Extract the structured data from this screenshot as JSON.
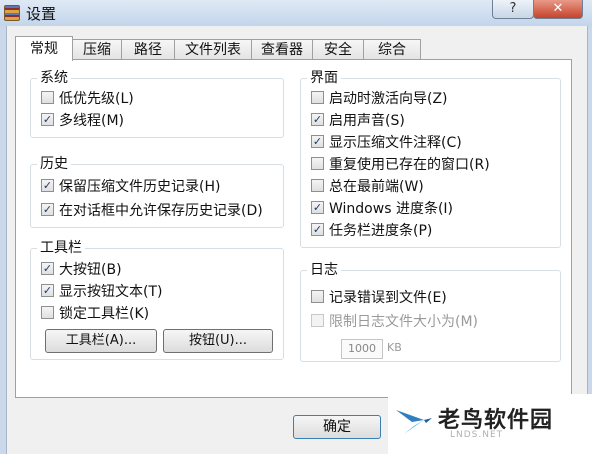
{
  "window": {
    "title": "设置",
    "help_label": "?",
    "close_label": "✕"
  },
  "tabs": [
    {
      "label": "常规",
      "active": true
    },
    {
      "label": "压缩"
    },
    {
      "label": "路径"
    },
    {
      "label": "文件列表"
    },
    {
      "label": "查看器"
    },
    {
      "label": "安全"
    },
    {
      "label": "综合"
    }
  ],
  "system": {
    "title": "系统",
    "items": [
      {
        "label": "低优先级(L)",
        "checked": false
      },
      {
        "label": "多线程(M)",
        "checked": true
      }
    ]
  },
  "history": {
    "title": "历史",
    "items": [
      {
        "label": "保留压缩文件历史记录(H)",
        "checked": true
      },
      {
        "label": "在对话框中允许保存历史记录(D)",
        "checked": true
      }
    ]
  },
  "toolbar": {
    "title": "工具栏",
    "items": [
      {
        "label": "大按钮(B)",
        "checked": true
      },
      {
        "label": "显示按钮文本(T)",
        "checked": true
      },
      {
        "label": "锁定工具栏(K)",
        "checked": false
      }
    ],
    "toolbar_button": "工具栏(A)...",
    "buttons_button": "按钮(U)..."
  },
  "interface": {
    "title": "界面",
    "items": [
      {
        "label": "启动时激活向导(Z)",
        "checked": false
      },
      {
        "label": "启用声音(S)",
        "checked": true
      },
      {
        "label": "显示压缩文件注释(C)",
        "checked": true
      },
      {
        "label": "重复使用已存在的窗口(R)",
        "checked": false
      },
      {
        "label": "总在最前端(W)",
        "checked": false
      },
      {
        "label": "Windows 进度条(I)",
        "checked": true
      },
      {
        "label": "任务栏进度条(P)",
        "checked": true
      }
    ]
  },
  "log": {
    "title": "日志",
    "items": [
      {
        "label": "记录错误到文件(E)",
        "checked": false,
        "disabled": false
      },
      {
        "label": "限制日志文件大小为(M)",
        "checked": false,
        "disabled": true
      }
    ],
    "size_value": "1000",
    "size_unit": "KB"
  },
  "footer": {
    "ok_label": "确定"
  },
  "watermark": {
    "text": "老鸟软件园",
    "sub": "LNDS.NET"
  }
}
